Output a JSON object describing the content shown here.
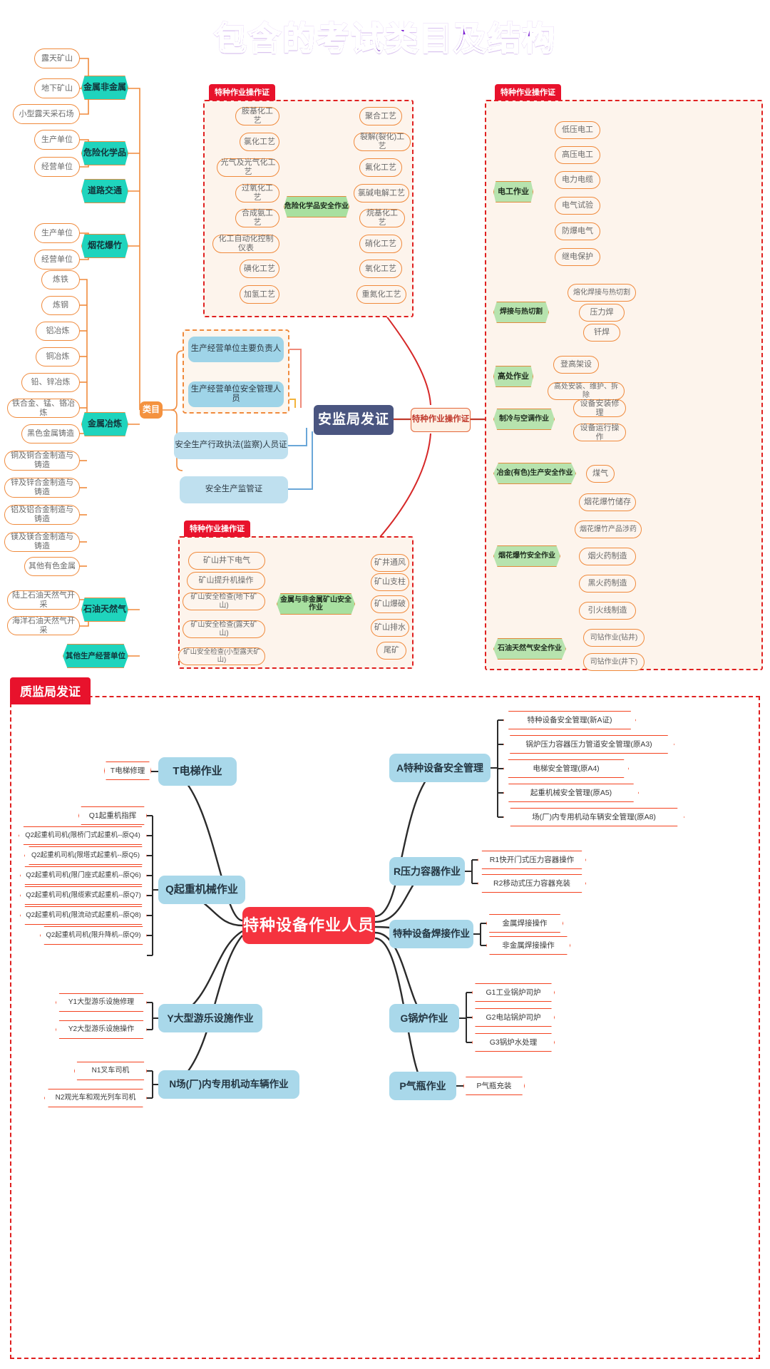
{
  "title": "包含的考试类目及结构",
  "panels": {
    "hazchem_label": "特种作业操作证",
    "mine_label": "特种作业操作证",
    "right_label": "特种作业操作证",
    "quality_label": "质监局发证"
  },
  "hubs": {
    "anjian": "安监局发证",
    "special_op_cert": "特种作业操作证",
    "leimu": "类目",
    "equipment_person": "特种设备作业人员"
  },
  "center_blue": [
    "生产经营单位主要负责人",
    "生产经营单位安全管理人员",
    "安全生产行政执法(监察)人员证",
    "安全生产监管证"
  ],
  "left_branch": [
    {
      "category": "金属非金属",
      "items": [
        "露天矿山",
        "地下矿山",
        "小型露天采石场"
      ]
    },
    {
      "category": "危险化学品",
      "items": [
        "生产单位",
        "经营单位"
      ]
    },
    {
      "category": "道路交通",
      "items": []
    },
    {
      "category": "烟花爆竹",
      "items": [
        "生产单位",
        "经营单位"
      ]
    },
    {
      "category": "金属冶炼",
      "items": [
        "炼铁",
        "炼钢",
        "铝冶炼",
        "铜冶炼",
        "铅、锌冶炼",
        "铁合金、锰、铬冶炼",
        "黑色金属铸造",
        "铜及铜合金制造与铸造",
        "锌及锌合金制造与铸造",
        "铝及铝合金制造与铸造",
        "镁及镁合金制造与铸造",
        "其他有色金属"
      ]
    },
    {
      "category": "石油天然气",
      "items": [
        "陆上石油天然气开采",
        "海洋石油天然气开采"
      ]
    },
    {
      "category": "其他生产经营单位",
      "items": []
    }
  ],
  "hazchem": {
    "head": "危险化学品安全作业",
    "left": [
      "胺基化工艺",
      "氯化工艺",
      "光气及光气化工艺",
      "过氧化工艺",
      "合成氨工艺",
      "化工自动化控制仪表",
      "磺化工艺",
      "加氢工艺"
    ],
    "right": [
      "聚合工艺",
      "裂解(裂化)工艺",
      "氟化工艺",
      "氯碱电解工艺",
      "烷基化工艺",
      "硝化工艺",
      "氧化工艺",
      "重氮化工艺"
    ]
  },
  "mine": {
    "head": "金属与非金属矿山安全作业",
    "left": [
      "矿山井下电气",
      "矿山提升机操作",
      "矿山安全检查(地下矿山)",
      "矿山安全检查(露天矿山)",
      "矿山安全检查(小型露天矿山)"
    ],
    "right": [
      "矿井通风",
      "矿山支柱",
      "矿山爆破",
      "矿山排水",
      "尾矿"
    ]
  },
  "right_branch": [
    {
      "category": "电工作业",
      "items": [
        "低压电工",
        "高压电工",
        "电力电缆",
        "电气试验",
        "防爆电气",
        "继电保护"
      ]
    },
    {
      "category": "焊接与热切割",
      "items": [
        "熔化焊接与热切割",
        "压力焊",
        "钎焊"
      ]
    },
    {
      "category": "高处作业",
      "items": [
        "登高架设",
        "高处安装、维护、拆除"
      ]
    },
    {
      "category": "制冷与空调作业",
      "items": [
        "设备安装修理",
        "设备运行操作"
      ]
    },
    {
      "category": "冶金(有色)生产安全作业",
      "items": [
        "煤气"
      ]
    },
    {
      "category": "烟花爆竹安全作业",
      "items": [
        "烟花爆竹储存",
        "烟花爆竹产品涉药",
        "烟火药制造",
        "黑火药制造",
        "引火线制造"
      ]
    },
    {
      "category": "石油天然气安全作业",
      "items": [
        "司钻作业(钻井)",
        "司钻作业(井下)"
      ]
    }
  ],
  "bottom_branch": [
    {
      "category": "T电梯作业",
      "side": "left",
      "items": [
        "T电梯修理"
      ]
    },
    {
      "category": "Q起重机械作业",
      "side": "left",
      "items": [
        "Q1起重机指挥",
        "Q2起重机司机(限桥门式起重机--原Q4)",
        "Q2起重机司机(限塔式起重机--原Q5)",
        "Q2起重机司机(限门座式起重机--原Q6)",
        "Q2起重机司机(限缆索式起重机--原Q7)",
        "Q2起重机司机(限流动式起重机--原Q8)",
        "Q2起重机司机(限升降机--原Q9)"
      ]
    },
    {
      "category": "Y大型游乐设施作业",
      "side": "left",
      "items": [
        "Y1大型游乐设施修理",
        "Y2大型游乐设施操作"
      ]
    },
    {
      "category": "N场(厂)内专用机动车辆作业",
      "side": "left",
      "items": [
        "N1叉车司机",
        "N2观光车和观光列车司机"
      ]
    },
    {
      "category": "A特种设备安全管理",
      "side": "right",
      "items": [
        "特种设备安全管理(新A证)",
        "锅炉压力容器压力管道安全管理(原A3)",
        "电梯安全管理(原A4)",
        "起重机械安全管理(原A5)",
        "场(厂)内专用机动车辆安全管理(原A8)"
      ]
    },
    {
      "category": "R压力容器作业",
      "side": "right",
      "items": [
        "R1快开门式压力容器操作",
        "R2移动式压力容器充装"
      ]
    },
    {
      "category": "特种设备焊接作业",
      "side": "right",
      "items": [
        "金属焊接操作",
        "非金属焊接操作"
      ]
    },
    {
      "category": "G锅炉作业",
      "side": "right",
      "items": [
        "G1工业锅炉司炉",
        "G2电站锅炉司炉",
        "G3锅炉水处理"
      ]
    },
    {
      "category": "P气瓶作业",
      "side": "right",
      "items": [
        "P气瓶充装"
      ]
    }
  ],
  "colors": {
    "orange_line": "#f08a3c",
    "teal": "#1fd4bd",
    "green": "#a8e0a0",
    "navy": "#4a5580",
    "red": "#f5333f",
    "blue": "#a9d8ea",
    "panel_red": "#e02020",
    "title_purple": "#7a18d6"
  }
}
